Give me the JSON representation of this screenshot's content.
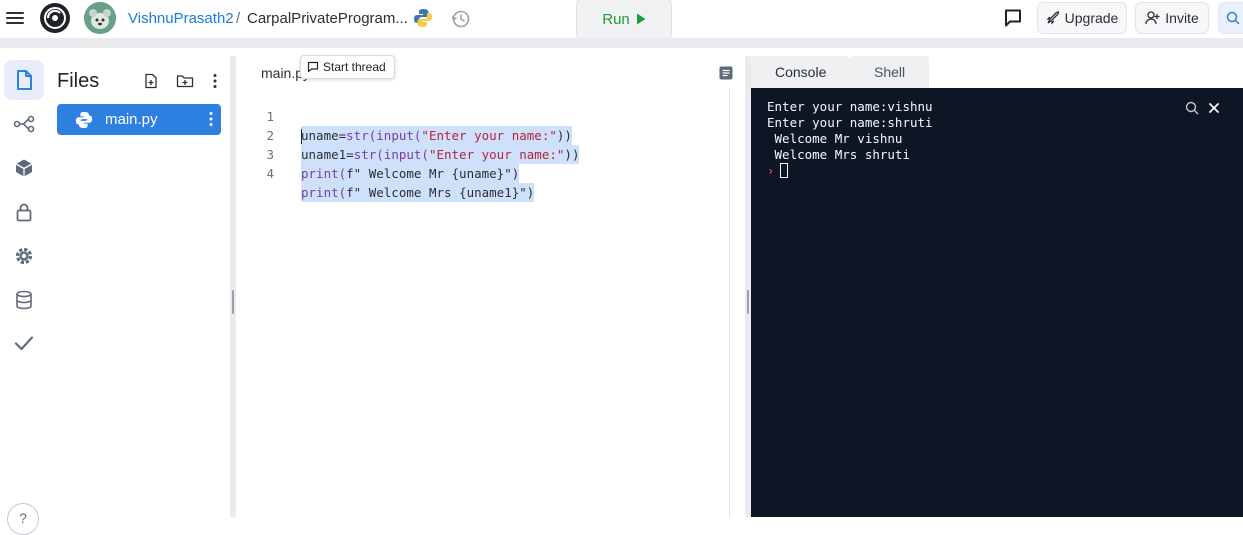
{
  "topbar": {
    "user": "VishnuPrasath2",
    "separator": "/",
    "repl_name": "CarpalPrivateProgram...",
    "run_label": "Run",
    "upgrade_label": "Upgrade",
    "invite_label": "Invite"
  },
  "files": {
    "title": "Files",
    "items": [
      {
        "name": "main.py"
      }
    ]
  },
  "editor": {
    "tab_label": "main.py",
    "tooltip": "Start thread",
    "lines": [
      {
        "n": "1",
        "a": "uname=",
        "b": "str(",
        "c": "input(",
        "d": "\"Enter your name:\"",
        "e": "))"
      },
      {
        "n": "2",
        "a": "uname1=",
        "b": "str(",
        "c": "input(",
        "d": "\"Enter your name:\"",
        "e": "))"
      },
      {
        "n": "3",
        "a": "print(",
        "b": "f\" Welcome Mr {uname}\"",
        "c": ")"
      },
      {
        "n": "4",
        "a": "print(",
        "b": "f\" Welcome Mrs {uname1}\"",
        "c": ")"
      }
    ]
  },
  "right_pane": {
    "tabs": [
      {
        "label": "Console"
      },
      {
        "label": "Shell"
      }
    ],
    "console_lines": [
      "Enter your name:vishnu",
      "Enter your name:shruti",
      " Welcome Mr vishnu",
      " Welcome Mrs shruti"
    ]
  },
  "help": {
    "label": "?"
  },
  "colors": {
    "accent": "#2e80e0",
    "run_green": "#1e9b3b",
    "console_bg": "#0e1525",
    "selection": "#cfe0fb"
  }
}
